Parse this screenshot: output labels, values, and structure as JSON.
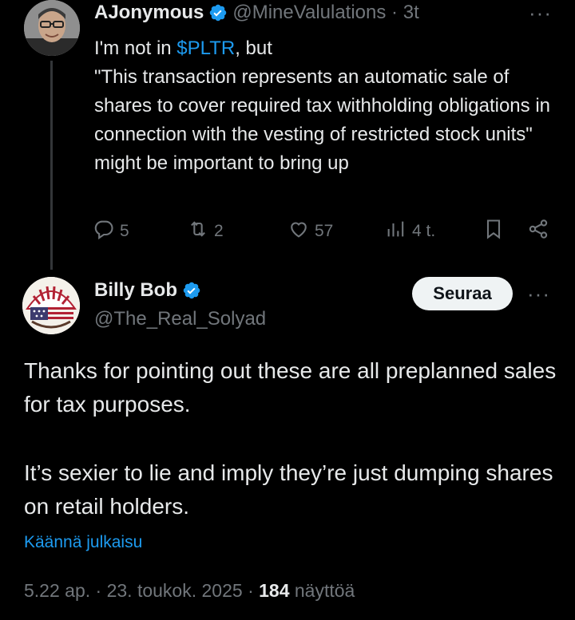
{
  "parent": {
    "name": "AJonymous",
    "handle": "@MineValulations",
    "separator": "·",
    "time": "3t",
    "more": "···",
    "text_prefix": "I'm not in ",
    "cashtag": "$PLTR",
    "text_suffix": ", but",
    "quote": "\"This transaction represents an automatic sale of shares to cover  required tax withholding obligations in connection with the vesting of restricted stock units\" might be important to bring up",
    "replies": "5",
    "reposts": "2",
    "likes": "57",
    "views": "4 t."
  },
  "reply": {
    "name": "Billy Bob",
    "handle": "@The_Real_Solyad",
    "follow_label": "Seuraa",
    "more": "···",
    "paragraph1": "Thanks for pointing out these are all preplanned sales for tax purposes.",
    "paragraph2": "It’s sexier to lie and imply they’re just dumping shares on retail holders.",
    "translate_label": "Käännä julkaisu",
    "time": "5.22 ap.",
    "date": "23. toukok. 2025",
    "sep": "·",
    "views_count": "184",
    "views_label": "näyttöä"
  },
  "colors": {
    "background": "#000000",
    "text": "#e7e9ea",
    "muted": "#71767b",
    "accent": "#1d9bf0",
    "follow_bg": "#eff3f4"
  },
  "icons": [
    "reply-icon",
    "repost-icon",
    "like-icon",
    "views-icon",
    "bookmark-icon",
    "share-icon",
    "verified-badge-icon"
  ]
}
